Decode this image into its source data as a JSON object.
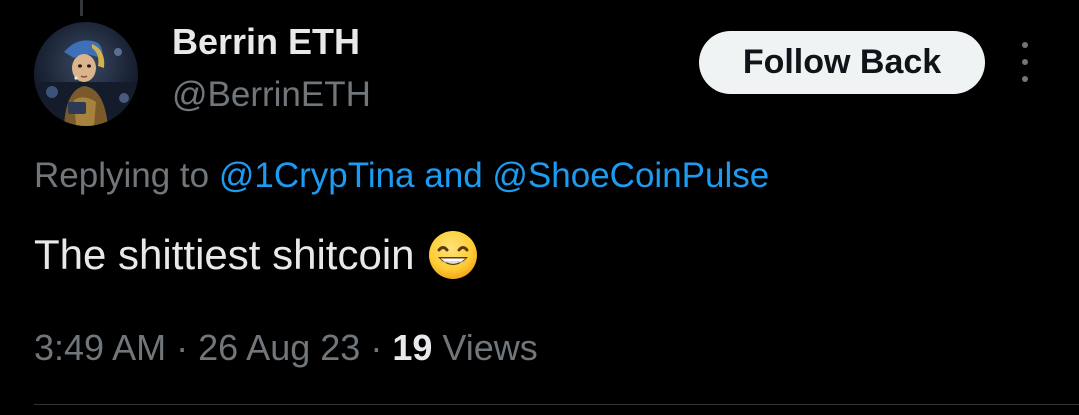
{
  "tweet": {
    "author": {
      "display_name": "Berrin ETH",
      "handle": "@BerrinETH"
    },
    "follow_button_label": "Follow Back",
    "replying_prefix": "Replying to",
    "mention_1": "@1CrypTina",
    "mention_joiner": "and",
    "mention_2": "@ShoeCoinPulse",
    "text": "The shittiest shitcoin",
    "emoji": "grinning-face-with-smiling-eyes",
    "time": "3:49 AM",
    "separator": "·",
    "date": "26 Aug 23",
    "views_count": "19",
    "views_label": "Views"
  },
  "colors": {
    "background": "#000000",
    "primary_text": "#e7e9ea",
    "secondary_text": "#71767b",
    "link": "#1d9bf0",
    "button_bg": "#eff3f4",
    "button_text": "#0f1419"
  }
}
